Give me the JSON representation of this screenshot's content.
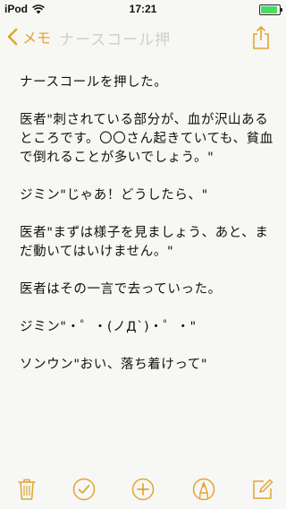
{
  "status_bar": {
    "carrier": "iPod",
    "time": "17:21"
  },
  "nav": {
    "back_label": "メモ",
    "faded_title": "ナースコール押"
  },
  "note": {
    "paragraphs": [
      "ナースコールを押した。",
      "医者\"刺されている部分が、血が沢山あるところです。〇〇さん起きていても、貧血で倒れることが多いでしょう。\"",
      "ジミン\"じゃあ！どうしたら、\"",
      "医者\"まずは様子を見ましょう、あと、まだ動いてはいけません。\"",
      "医者はその一言で去っていった。",
      "ジミン\"・゜・(ノД`)・゜・\"",
      "ソンウン\"おい、落ち着けって\""
    ]
  },
  "colors": {
    "accent": "#e1a530",
    "battery": "#4cd964",
    "background": "#f7f7f4"
  },
  "icons": {
    "back": "chevron-left-icon",
    "share": "share-icon",
    "trash": "trash-icon",
    "checklist": "checkmark-circle-icon",
    "add": "plus-circle-icon",
    "markup": "markup-pen-icon",
    "compose": "compose-icon"
  }
}
